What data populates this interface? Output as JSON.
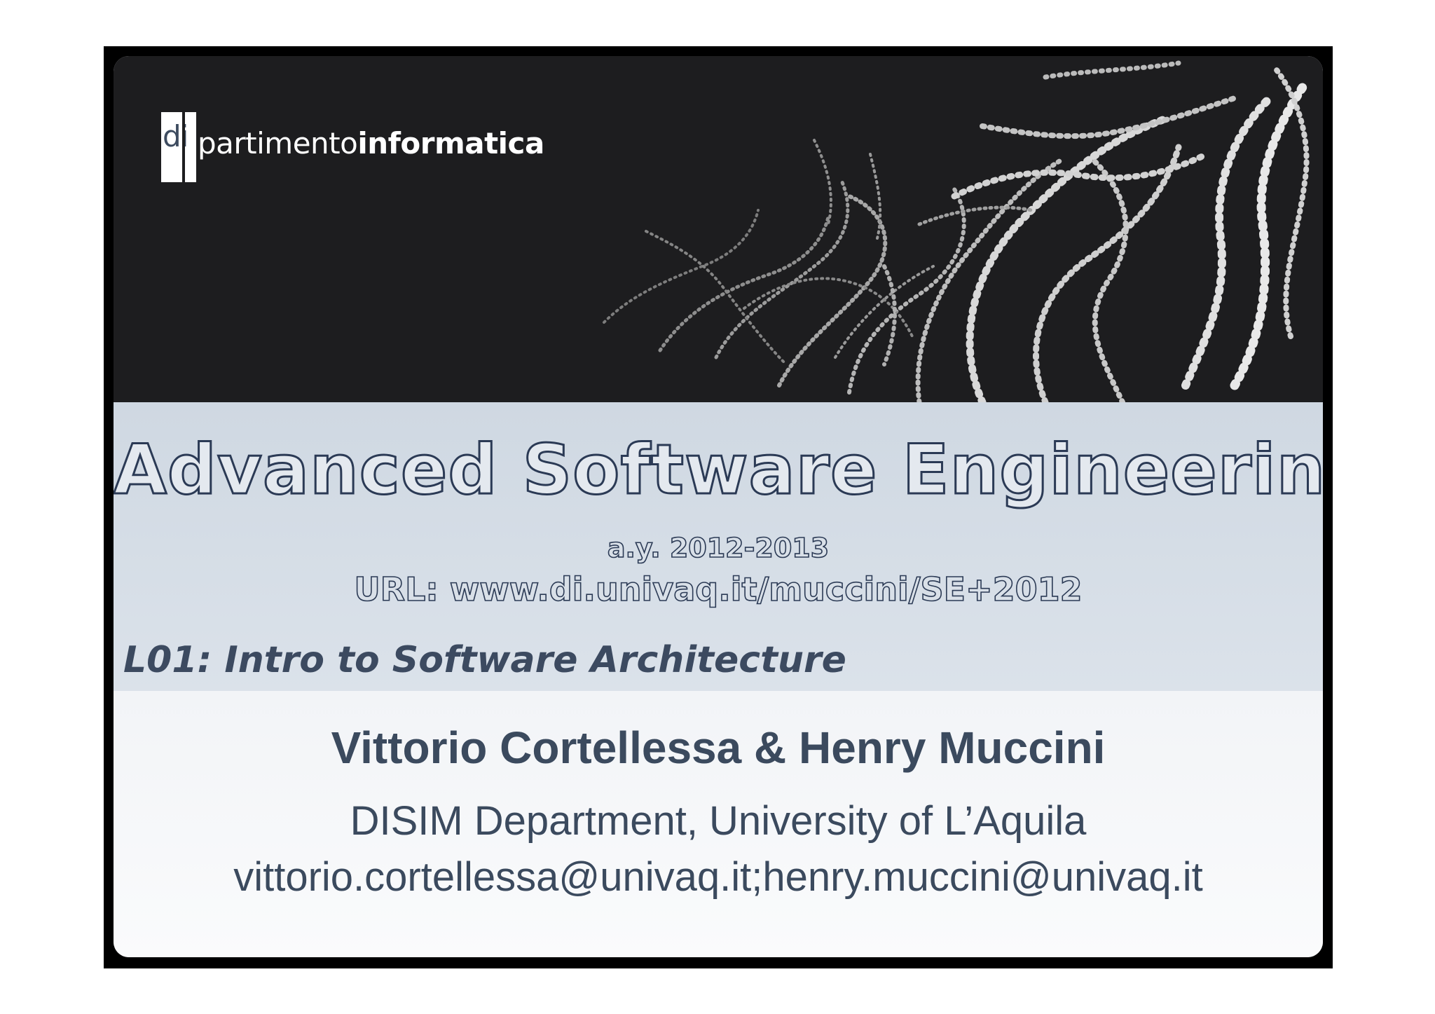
{
  "logo": {
    "mark": "di",
    "text_light": "partimento",
    "text_bold": "informatica"
  },
  "title": {
    "course": "Advanced Software Engineering",
    "year": "a.y. 2012-2013",
    "url": "URL: www.di.univaq.it/muccini/SE+2012",
    "lecture": "L01: Intro to Software Architecture"
  },
  "authors": {
    "names": "Vittorio Cortellessa & Henry Muccini",
    "department": "DISIM Department, University of L’Aquila",
    "emails": "vittorio.cortellessa@univaq.it;henry.muccini@univaq.it"
  },
  "colors": {
    "header_background": "#1d1d1f",
    "title_band": "#d5dde6",
    "text_dark_blue": "#3b4a5e"
  },
  "decoration": {
    "header_art": "binary-digit-streams"
  }
}
